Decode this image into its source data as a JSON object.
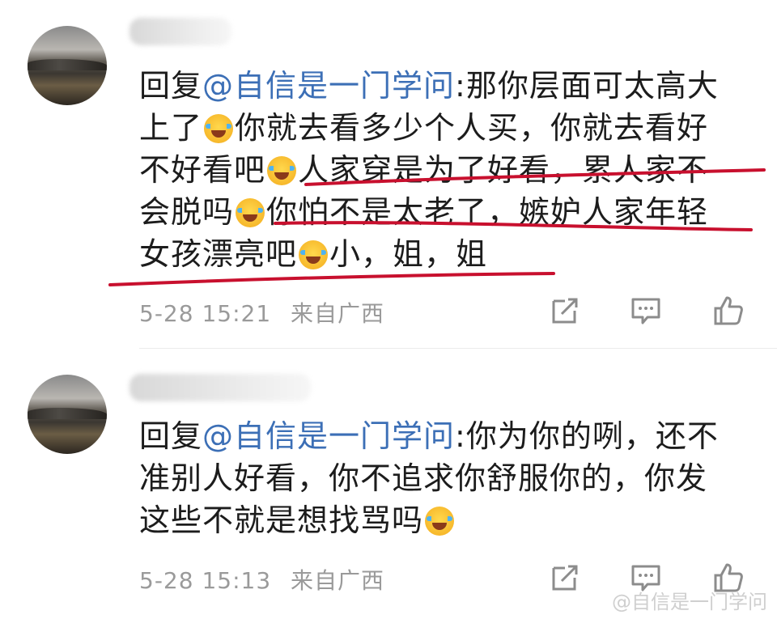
{
  "comments": [
    {
      "mention": "@自信是一门学问",
      "reply_prefix": "回复",
      "lines": [
        {
          "parts": [
            "",
            ":那你层面可太高大"
          ]
        },
        {
          "parts": [
            "上了",
            "你就去看多少个人买，你就去看好"
          ]
        },
        {
          "parts": [
            "不好看吧",
            "人家穿是为了好看，累人家不"
          ]
        },
        {
          "parts": [
            "会脱吗",
            "你怕不是太老了，嫉妒人家年轻"
          ]
        },
        {
          "parts": [
            "女孩漂亮吧",
            "小，姐，姐"
          ]
        }
      ],
      "time": "5-28 15:21",
      "location": "来自广西"
    },
    {
      "mention": "@自信是一门学问",
      "reply_prefix": "回复",
      "lines": [
        {
          "parts": [
            "",
            ":你为你的咧，还不"
          ]
        },
        {
          "parts": [
            "准别人好看，你不追求你舒服你的，你发"
          ]
        },
        {
          "parts": [
            "这些不就是想找骂吗"
          ]
        }
      ],
      "time": "5-28 15:13",
      "location": "来自广西"
    }
  ],
  "icons": [
    "share-icon",
    "comment-icon",
    "like-icon"
  ],
  "watermark": "@自信是一门学问",
  "colors": {
    "mention": "#3c6fb6",
    "meta": "#9a9a9a",
    "annotation": "#c8102e"
  }
}
